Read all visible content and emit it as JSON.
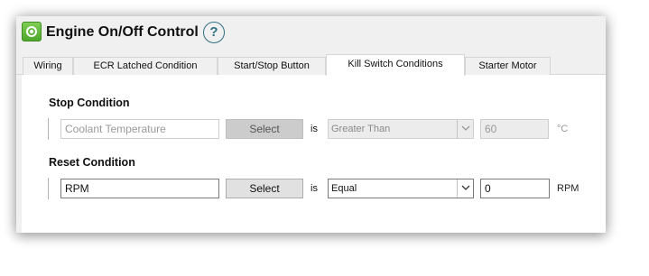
{
  "header": {
    "title": "Engine On/Off Control",
    "help_glyph": "?",
    "app_icon": "engine-power-icon",
    "help_icon": "help-icon",
    "accent_color": "#5db336"
  },
  "tabs": [
    {
      "label": "Wiring",
      "active": false
    },
    {
      "label": "ECR Latched Condition",
      "active": false
    },
    {
      "label": "Start/Stop Button",
      "active": false
    },
    {
      "label": "Kill Switch Conditions",
      "active": true
    },
    {
      "label": "Starter Motor",
      "active": false
    }
  ],
  "stop_condition": {
    "title": "Stop Condition",
    "parameter_placeholder": "Coolant Temperature",
    "parameter_value": "",
    "select_label": "Select",
    "is_label": "is",
    "operator": "Greater Than",
    "value": "60",
    "unit": "°C",
    "enabled": false
  },
  "reset_condition": {
    "title": "Reset Condition",
    "parameter_value": "RPM",
    "select_label": "Select",
    "is_label": "is",
    "operator": "Equal",
    "value": "0",
    "unit": "RPM",
    "enabled": true
  }
}
